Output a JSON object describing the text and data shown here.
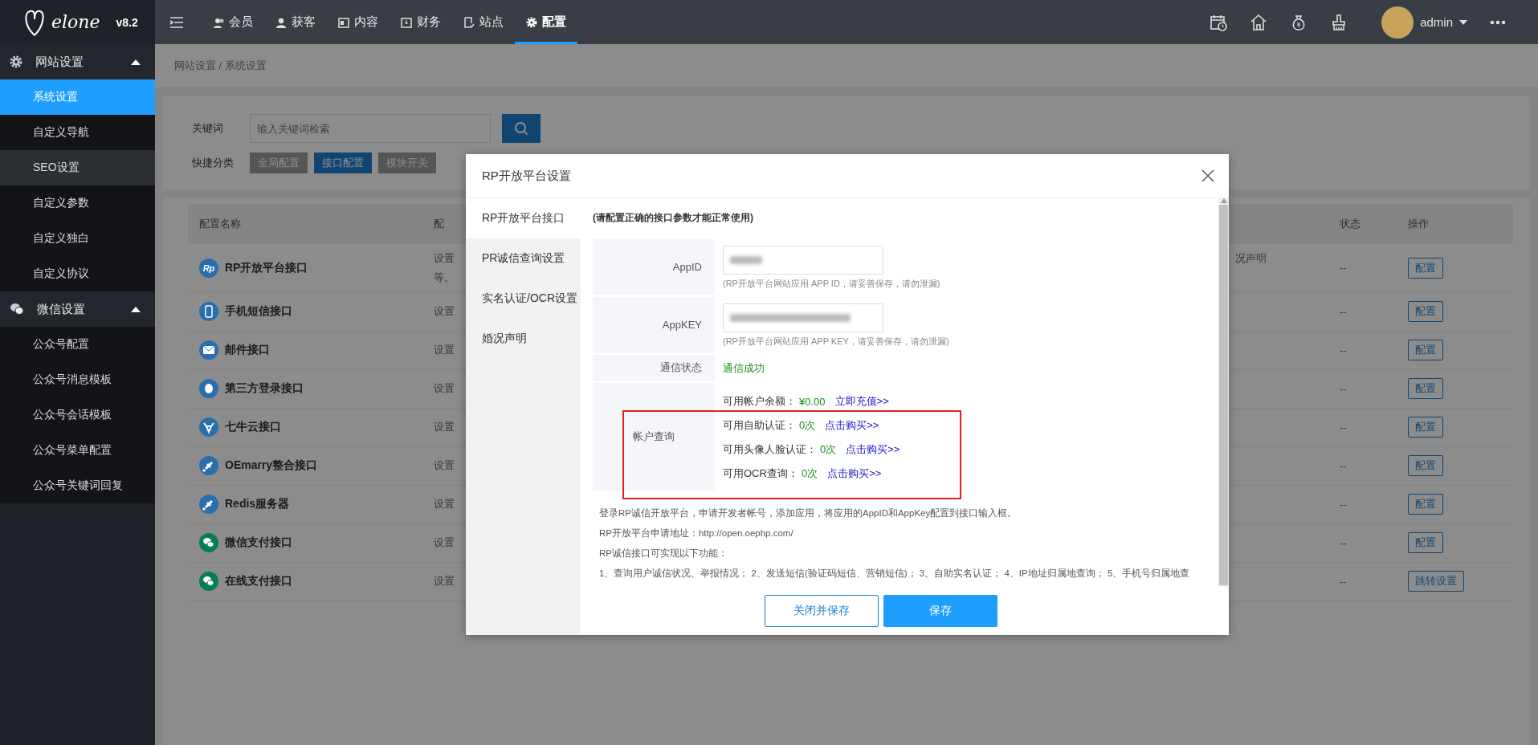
{
  "logo": {
    "wordmark": "elone",
    "version": "v8.2"
  },
  "top_nav": [
    {
      "label": "会员",
      "kind": "users",
      "selected": false
    },
    {
      "label": "获客",
      "kind": "user",
      "selected": false
    },
    {
      "label": "内容",
      "kind": "content",
      "selected": false
    },
    {
      "label": "财务",
      "kind": "finance",
      "selected": false
    },
    {
      "label": "站点",
      "kind": "site",
      "selected": false
    },
    {
      "label": "配置",
      "kind": "gear",
      "selected": true
    }
  ],
  "user": {
    "name": "admin"
  },
  "sidebar": [
    {
      "label": "网站设置",
      "kind": "gear",
      "expanded": true,
      "items": [
        {
          "label": "系统设置",
          "selected": true,
          "hovered": false
        },
        {
          "label": "自定义导航",
          "selected": false,
          "hovered": false
        },
        {
          "label": "SEO设置",
          "selected": false,
          "hovered": true
        },
        {
          "label": "自定义参数",
          "selected": false,
          "hovered": false
        },
        {
          "label": "自定义独白",
          "selected": false,
          "hovered": false
        },
        {
          "label": "自定义协议",
          "selected": false,
          "hovered": false
        }
      ]
    },
    {
      "label": "微信设置",
      "kind": "wechat",
      "expanded": true,
      "items": [
        {
          "label": "公众号配置",
          "selected": false,
          "hovered": false
        },
        {
          "label": "公众号消息模板",
          "selected": false,
          "hovered": false
        },
        {
          "label": "公众号会话模板",
          "selected": false,
          "hovered": false
        },
        {
          "label": "公众号菜单配置",
          "selected": false,
          "hovered": false
        },
        {
          "label": "公众号关键词回复",
          "selected": false,
          "hovered": false
        }
      ]
    }
  ],
  "breadcrumb": "网站设置 / 系统设置",
  "search": {
    "label": "关键词",
    "placeholder": "输入关键词检索"
  },
  "quick_filter": {
    "label": "快捷分类",
    "options": [
      {
        "label": "全局配置",
        "selected": false
      },
      {
        "label": "接口配置",
        "selected": true
      },
      {
        "label": "模块开关",
        "selected": false
      }
    ]
  },
  "table": {
    "columns": [
      "配置名称",
      "配",
      "状态",
      "操作"
    ],
    "rows": [
      {
        "name": "RP开放平台接口",
        "kind": "rp",
        "badge": "Rp",
        "color": "#2a6fad",
        "desc": [
          "设置",
          "等。"
        ],
        "column_3": "况声明",
        "status": "--",
        "action": "配置"
      },
      {
        "name": "手机短信接口",
        "kind": "phone",
        "color": "#2a6fad",
        "desc": [
          "设置"
        ],
        "status": "--",
        "action": "配置"
      },
      {
        "name": "邮件接口",
        "kind": "mail",
        "color": "#2a6fad",
        "desc": [
          "设置"
        ],
        "status": "--",
        "action": "配置"
      },
      {
        "name": "第三方登录接口",
        "kind": "penguin",
        "color": "#2a6fad",
        "desc": [
          "设置"
        ],
        "status": "--",
        "action": "配置"
      },
      {
        "name": "七牛云接口",
        "kind": "bull",
        "color": "#2a6fad",
        "desc": [
          "设置"
        ],
        "status": "--",
        "action": "配置"
      },
      {
        "name": "OEmarry整合接口",
        "kind": "plug",
        "color": "#2a6fad",
        "desc": [
          "设置"
        ],
        "status": "--",
        "action": "配置"
      },
      {
        "name": "Redis服务器",
        "kind": "plug",
        "color": "#2a6fad",
        "desc": [
          "设置"
        ],
        "status": "--",
        "action": "配置"
      },
      {
        "name": "微信支付接口",
        "kind": "wechat",
        "color": "#0b7a57",
        "desc": [
          "设置"
        ],
        "status": "--",
        "action": "配置"
      },
      {
        "name": "在线支付接口",
        "kind": "wechat",
        "color": "#0b7a57",
        "desc": [
          "设置"
        ],
        "status": "--",
        "action": "跳转设置"
      }
    ]
  },
  "modal": {
    "title": "RP开放平台设置",
    "tabs": [
      {
        "label": "RP开放平台接口",
        "selected": true
      },
      {
        "label": "PR诚信查询设置",
        "selected": false
      },
      {
        "label": "实名认证/OCR设置",
        "selected": false
      },
      {
        "label": "婚况声明",
        "selected": false
      }
    ],
    "notice": "(请配置正确的接口参数才能正常使用)",
    "fields": [
      {
        "label": "AppID",
        "kind": "input",
        "hint": "(RP开放平台网站应用 APP ID，请妥善保存，请勿泄漏)"
      },
      {
        "label": "AppKEY",
        "kind": "input",
        "hint": "(RP开放平台网站应用 APP KEY，请妥善保存，请勿泄漏)"
      },
      {
        "label": "通信状态",
        "kind": "status",
        "value": "通信成功"
      },
      {
        "label": "帐户查询",
        "kind": "account",
        "lines": [
          {
            "label": "可用帐户余额：",
            "value": "¥0.00",
            "link": "立即充值>>"
          },
          {
            "label": "可用自助认证：",
            "value": "0次",
            "link": "点击购买>>"
          },
          {
            "label": "可用头像人脸认证：",
            "value": "0次",
            "link": "点击购买>>"
          },
          {
            "label": "可用OCR查询：",
            "value": "0次",
            "link": "点击购买>>"
          }
        ]
      }
    ],
    "notes": [
      "登录RP诚信开放平台，申请开发者帐号，添加应用，将应用的AppID和AppKey配置到接口输入框。",
      "RP开放平台申请地址：http://open.oephp.com/",
      "RP诚信接口可实现以下功能：",
      "1、查询用户诚信状况、举报情况； 2、发送短信(验证码短信、营销短信)； 3、自助实名认证； 4、IP地址归属地查询； 5、手机号归属地查"
    ],
    "buttons": [
      {
        "label": "关闭并保存",
        "kind": "secondary"
      },
      {
        "label": "保存",
        "kind": "primary"
      }
    ]
  }
}
